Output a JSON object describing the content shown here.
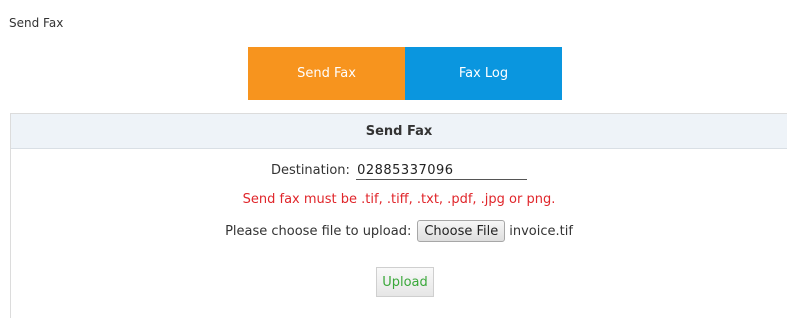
{
  "page": {
    "heading": "Send Fax"
  },
  "tabs": [
    {
      "label": "Send Fax",
      "active": true,
      "color": "#f7941e"
    },
    {
      "label": "Fax Log",
      "active": false,
      "color": "#0a96df"
    }
  ],
  "panel": {
    "title": "Send Fax",
    "destination_label": "Destination:",
    "destination_value": "02885337096",
    "warning": "Send fax must be .tif, .tiff, .txt, .pdf, .jpg or png.",
    "file_label": "Please choose file to upload:",
    "choose_file_label": "Choose File",
    "selected_file": "invoice.tif",
    "upload_label": "Upload"
  },
  "colors": {
    "warning": "#e0262b",
    "upload_text": "#3aa83a",
    "header_bg": "#eef3f8"
  }
}
